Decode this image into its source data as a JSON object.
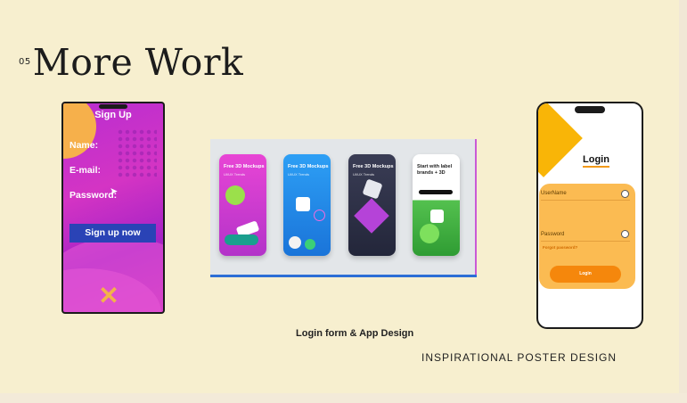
{
  "heading": {
    "number": "05",
    "title": "More Work"
  },
  "signup_phone": {
    "title": "Sign Up",
    "name_label": "Name:",
    "email_label": "E-mail:",
    "password_label": "Password:",
    "button_label": "Sign up now",
    "close_icon": "✕",
    "colors": {
      "background": "#c22fc6",
      "button": "#2a43b6",
      "accent": "#f6b04b"
    }
  },
  "mockups": {
    "cards": [
      {
        "title": "Free 3D Mockups",
        "subtitle": "UI/UX Trends",
        "color": "#d93fd0"
      },
      {
        "title": "Free 3D Mockups",
        "subtitle": "UI/UX Trends",
        "color": "#1b8ef1"
      },
      {
        "title": "Free 3D Mockups",
        "subtitle": "UI/UX Trends",
        "color": "#2f3245"
      },
      {
        "title": "Start with label brands + 3D",
        "subtitle": "",
        "color": "#ffffff"
      }
    ]
  },
  "login_phone": {
    "title": "Login",
    "username_label": "UserName",
    "password_label": "Password",
    "forgot_label": "Forgot password?",
    "button_label": "Login",
    "colors": {
      "card": "#fbbb52",
      "accent": "#f9b507",
      "button": "#f5870c"
    }
  },
  "captions": {
    "login": "Login form & App Design",
    "poster": "INSPIRATIONAL POSTER DESIGN"
  }
}
